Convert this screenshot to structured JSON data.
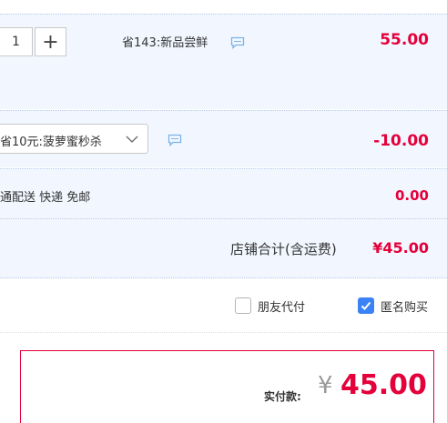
{
  "item": {
    "quantity": "1",
    "plus": "+",
    "promo": "省143:新品尝鲜",
    "price": "55.00"
  },
  "shop_promo": {
    "selected": "省10元:菠萝蜜秒杀",
    "amount": "-10.00"
  },
  "shipping": {
    "label": "通配送 快递 免邮",
    "amount": "0.00"
  },
  "shop_total": {
    "label": "店铺合计(含运费)",
    "amount": "¥45.00"
  },
  "options": {
    "friend_pay": {
      "label": "朋友代付",
      "checked": false
    },
    "anonymous": {
      "label": "匿名购买",
      "checked": true
    }
  },
  "payment": {
    "label": "实付款:",
    "currency": "¥",
    "amount": "45.00"
  },
  "colors": {
    "price_red": "#e4003a",
    "row_blue": "#f2f7ff",
    "check_blue": "#3b82f6",
    "pay_border": "#e4003a"
  }
}
